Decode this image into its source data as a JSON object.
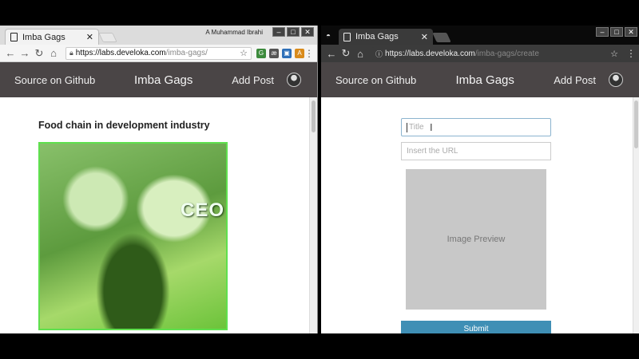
{
  "colors": {
    "navbar_bg": "#4a4546",
    "submit_bg": "#3f8fb5",
    "image_border": "#5fe04e",
    "preview_bg": "#c8c8c8"
  },
  "icons": [
    "page-icon",
    "back-arrow-icon",
    "forward-arrow-icon",
    "reload-icon",
    "home-icon",
    "lock-icon",
    "star-icon",
    "menu-dots-icon",
    "close-icon",
    "incognito-icon",
    "avatar"
  ],
  "left_browser": {
    "tab_title": "Imba Gags",
    "tab_close": "✕",
    "profile_name": "A Muhammad Ibrahi",
    "url_host": "https://labs.develoka.com",
    "url_path": "/imba-gags/",
    "extensions": [
      "G",
      "æ",
      "▣",
      "A"
    ],
    "nav": {
      "source_link": "Source on Github",
      "brand": "Imba Gags",
      "add_post": "Add Post"
    },
    "post": {
      "title": "Food chain in development industry",
      "image_caption": "CEO"
    }
  },
  "right_browser": {
    "tab_title": "Imba Gags",
    "tab_close": "✕",
    "url_host": "https://labs.develoka.com",
    "url_path": "/imba-gags/create",
    "nav": {
      "source_link": "Source on Github",
      "brand": "Imba Gags",
      "add_post": "Add Post"
    },
    "form": {
      "title_placeholder": "Title",
      "url_placeholder": "Insert the URL",
      "preview_label": "Image Preview",
      "submit_label": "Submit"
    }
  }
}
